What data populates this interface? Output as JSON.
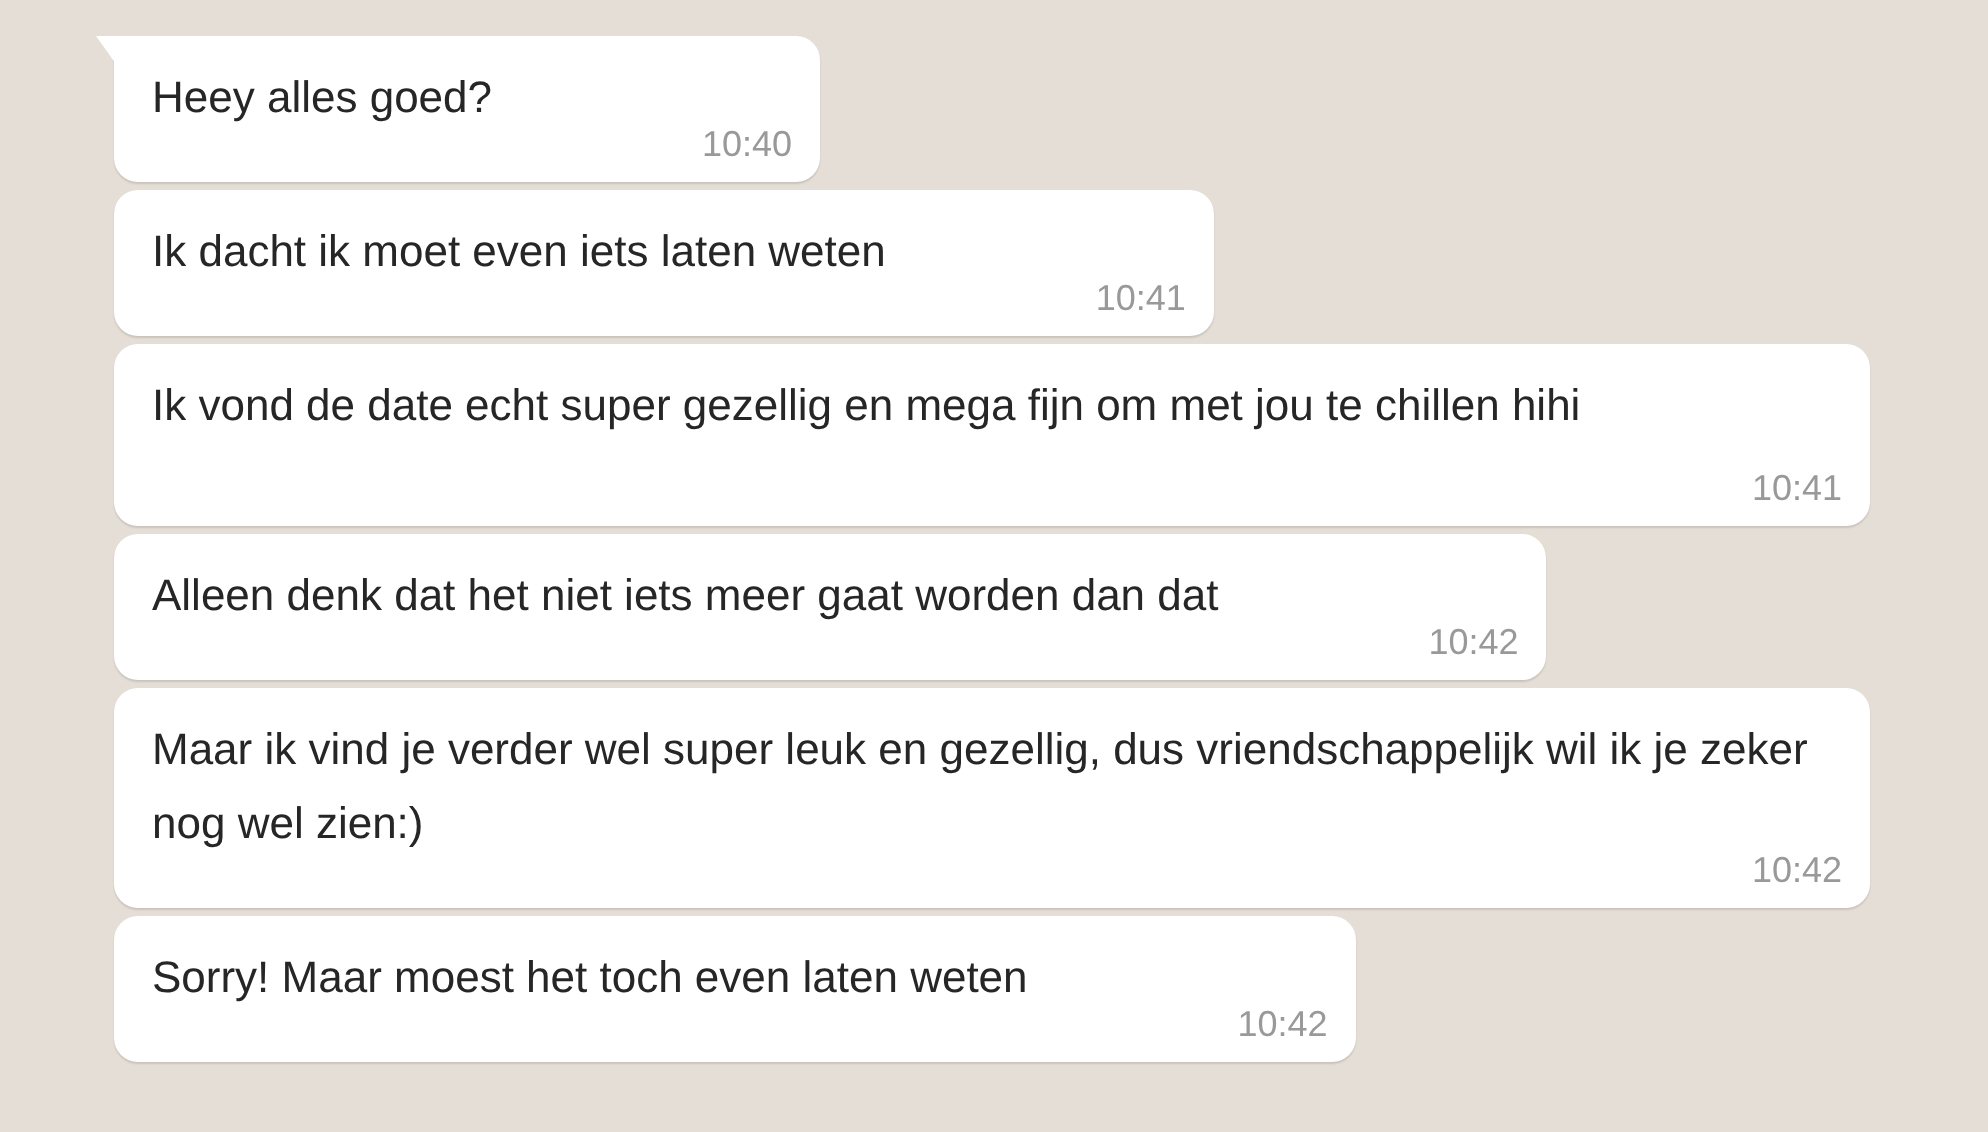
{
  "messages": [
    {
      "text": "Heey alles goed?",
      "time": "10:40",
      "tail": true
    },
    {
      "text": "Ik dacht ik moet even iets laten weten",
      "time": "10:41",
      "tail": false
    },
    {
      "text": "Ik vond de date echt super gezellig en mega fijn om met jou te chillen hihi",
      "time": "10:41",
      "tail": false
    },
    {
      "text": "Alleen denk dat het niet iets meer gaat worden dan dat",
      "time": "10:42",
      "tail": false
    },
    {
      "text": "Maar ik vind je verder wel super leuk en gezellig, dus vriendschappelijk wil ik je zeker nog wel zien:)",
      "time": "10:42",
      "tail": false
    },
    {
      "text": "Sorry! Maar moest het toch even laten weten",
      "time": "10:42",
      "tail": false
    }
  ]
}
